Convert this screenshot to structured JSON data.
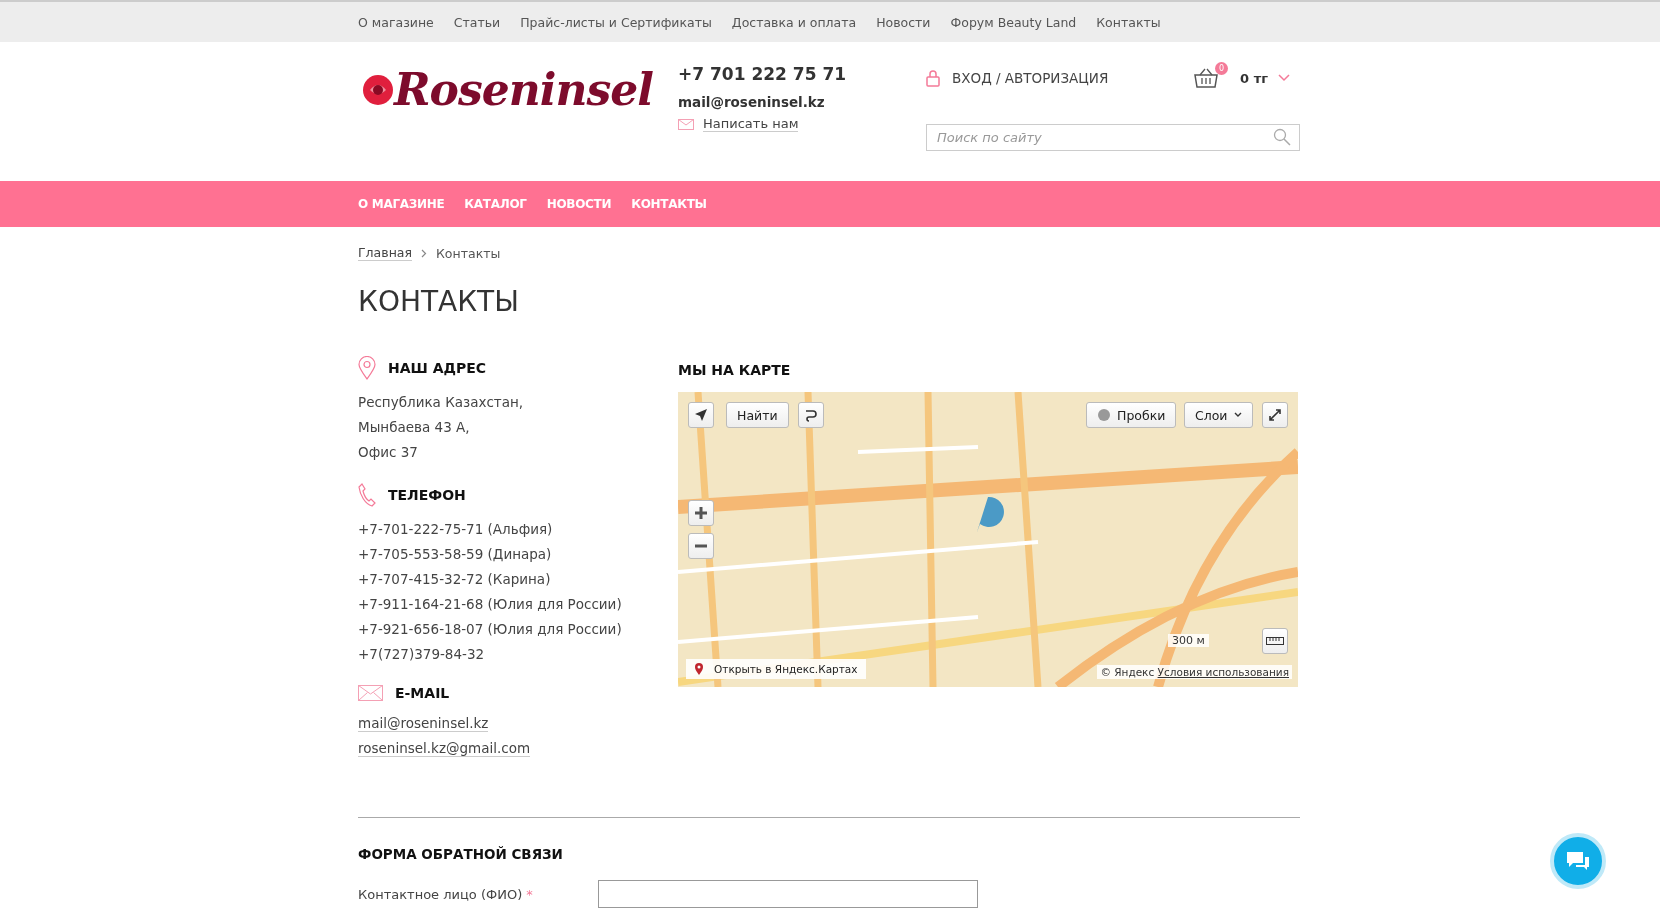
{
  "top_menu": [
    {
      "label": "О магазине"
    },
    {
      "label": "Статьи"
    },
    {
      "label": "Прайс-листы и Сертификаты"
    },
    {
      "label": "Доставка и оплата"
    },
    {
      "label": "Новости"
    },
    {
      "label": "Форум Beauty Land"
    },
    {
      "label": "Контакты"
    }
  ],
  "header": {
    "logo": "Roseninsel",
    "phone": "+7 701 222 75 71",
    "email": "mail@roseninsel.kz",
    "write_link": "Написать нам",
    "login": "ВХОД / АВТОРИЗАЦИЯ",
    "cart_count": "0",
    "cart_total": "0 тг",
    "search": {
      "placeholder": "Поиск по сайту"
    }
  },
  "main_nav": [
    {
      "label": "О МАГАЗИНЕ"
    },
    {
      "label": "КАТАЛОГ"
    },
    {
      "label": "НОВОСТИ"
    },
    {
      "label": "КОНТАКТЫ"
    }
  ],
  "breadcrumbs": [
    {
      "label": "Главная",
      "kind": "link"
    },
    {
      "label": "Контакты",
      "kind": "current"
    }
  ],
  "title": "КОНТАКТЫ",
  "sections": [
    {
      "kind": "address",
      "heading": "НАШ АДРЕС",
      "lines": [
        "Республика Казахстан,",
        "Мынбаева 43 А,",
        "Офис 37"
      ]
    },
    {
      "kind": "phone",
      "heading": "ТЕЛЕФОН",
      "lines": [
        "+7-701-222-75-71 (Альфия)",
        "+7-705-553-58-59 (Динара)",
        "+7-707-415-32-72 (Карина)",
        "+7-911-164-21-68 (Юлия для России)",
        "+7-921-656-18-07 (Юлия для России)",
        "+7(727)379-84-32"
      ]
    },
    {
      "kind": "email",
      "heading": "E-MAIL",
      "links": [
        "mail@roseninsel.kz",
        "roseninsel.kz@gmail.com"
      ]
    }
  ],
  "map": {
    "heading": "МЫ НА КАРТЕ",
    "find_button": "Найти",
    "traffic_button": "Пробки",
    "layers_button": "Слои",
    "open_link": "Открыть в Яндекс.Картах",
    "scale": "300 м",
    "copyright": "© Яндекс",
    "terms_link": "Условия использования"
  },
  "feedback": {
    "heading": "ФОРМА ОБРАТНОЙ СВЯЗИ",
    "fields": [
      {
        "label": "Контактное лицо (ФИО)",
        "required": true,
        "required_mark": "*"
      }
    ]
  }
}
